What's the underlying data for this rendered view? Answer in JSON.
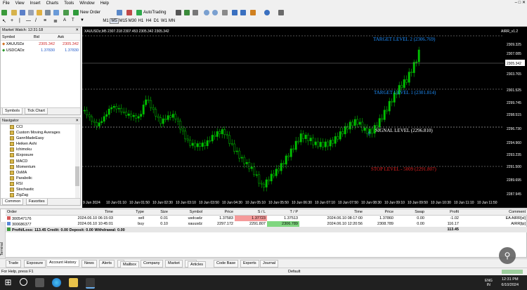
{
  "menu": [
    "File",
    "View",
    "Insert",
    "Charts",
    "Tools",
    "Window",
    "Help"
  ],
  "toolbar": {
    "new_order": "New Order",
    "autotrading": "AutoTrading"
  },
  "timeframes": [
    "M1",
    "M5",
    "M15",
    "M30",
    "H1",
    "H4",
    "D1",
    "W1",
    "MN"
  ],
  "market_watch": {
    "title": "Market Watch: 12:31:18",
    "columns": [
      "Symbol",
      "Bid",
      "Ask"
    ],
    "rows": [
      {
        "symbol": "XAUUSDz",
        "bid": "2305.342",
        "ask": "2305.342",
        "color": "#d02828"
      },
      {
        "symbol": "USDCADz",
        "bid": "1.37830",
        "ask": "1.37830",
        "color": "#1f58c8"
      }
    ],
    "tabs": [
      "Symbols",
      "Tick Chart"
    ]
  },
  "navigator": {
    "title": "Navigator",
    "items": [
      "CCI",
      "Custom Moving Averages",
      "GannMadeEasy",
      "Heiken Ashi",
      "Ichimoku",
      "iExposure",
      "MACD",
      "Momentum",
      "OsMA",
      "Parabolic",
      "RSI",
      "Stochastic",
      "ZigZag"
    ],
    "tabs": [
      "Common",
      "Favorites"
    ]
  },
  "chart": {
    "header": "XAUUSDz,M5  2307.218 2307.453 2305.342 2305.342",
    "corner_label": "AIRR_v1.2",
    "current_price": "2305.342",
    "price_axis": [
      "2309.325",
      "2307.085",
      "2305.342",
      "2303.765",
      "2301.525",
      "2299.745",
      "2298.515",
      "2296.730",
      "2294.960",
      "2293.235",
      "2291.500",
      "2289.695",
      "2287.945"
    ],
    "time_axis": [
      "9 Jun 2024",
      "10 Jun 01:10",
      "10 Jun 01:50",
      "10 Jun 02:30",
      "10 Jun 03:10",
      "10 Jun 03:50",
      "10 Jun 04:30",
      "10 Jun 05:10",
      "10 Jun 05:50",
      "10 Jun 06:30",
      "10 Jun 07:10",
      "10 Jun 07:50",
      "10 Jun 08:30",
      "10 Jun 09:10",
      "10 Jun 09:50",
      "10 Jun 10:30",
      "10 Jun 11:10",
      "10 Jun 11:50"
    ],
    "levels": [
      {
        "label": "TARGET LEVEL 2 (2306.769)",
        "color": "#1e90ff"
      },
      {
        "label": "TARGET LEVEL 1 (2301.814)",
        "color": "#1e90ff"
      },
      {
        "label": "SIGNAL LEVEL (2296.810)",
        "color": "#ffffff"
      },
      {
        "label": "STOP LEVEL - 5009 (2291.807)",
        "color": "#e02020"
      }
    ]
  },
  "orders": {
    "columns": [
      "Order",
      "Time",
      "Type",
      "Size",
      "Symbol",
      "Price",
      "S / L",
      "T / P",
      "Time",
      "Price",
      "Swap",
      "Profit",
      "Comment"
    ],
    "rows": [
      [
        "300547176",
        "2024.06.10 06:15:03",
        "sell",
        "0.01",
        "usdcadz",
        "1.37583",
        "1.37723",
        "1.37513",
        "2024.06.10 08:17:00",
        "1.37860",
        "0.00",
        "-1.02",
        "EA AIRR[sl]"
      ],
      [
        "300686377",
        "2024.06.10 10:45:01",
        "buy",
        "0.10",
        "xauusdz",
        "2297.172",
        "2291.807",
        "2306.789",
        "2024.06.10 12:20:56",
        "2308.789",
        "0.00",
        "116.17",
        "AIRR[tp]"
      ]
    ],
    "summary": "Profit/Loss: 113.45  Credit: 0.00  Deposit: 0.00  Withdrawal: 0.00",
    "summary_total": "113.45"
  },
  "bottom_tabs": [
    "Trade",
    "Exposure",
    "Account History",
    "News",
    "Alerts",
    "Mailbox",
    "Company",
    "Market",
    "Articles",
    "Code Base",
    "Experts",
    "Journal"
  ],
  "badges": {
    "mailbox": "8",
    "articles": "1003"
  },
  "terminal_label": "Terminal",
  "status": {
    "help": "For Help, press F1",
    "profile": "Default"
  },
  "taskbar": {
    "lang": "ENG",
    "region": "IN",
    "time": "12:31 PM",
    "date": "6/10/2024"
  }
}
